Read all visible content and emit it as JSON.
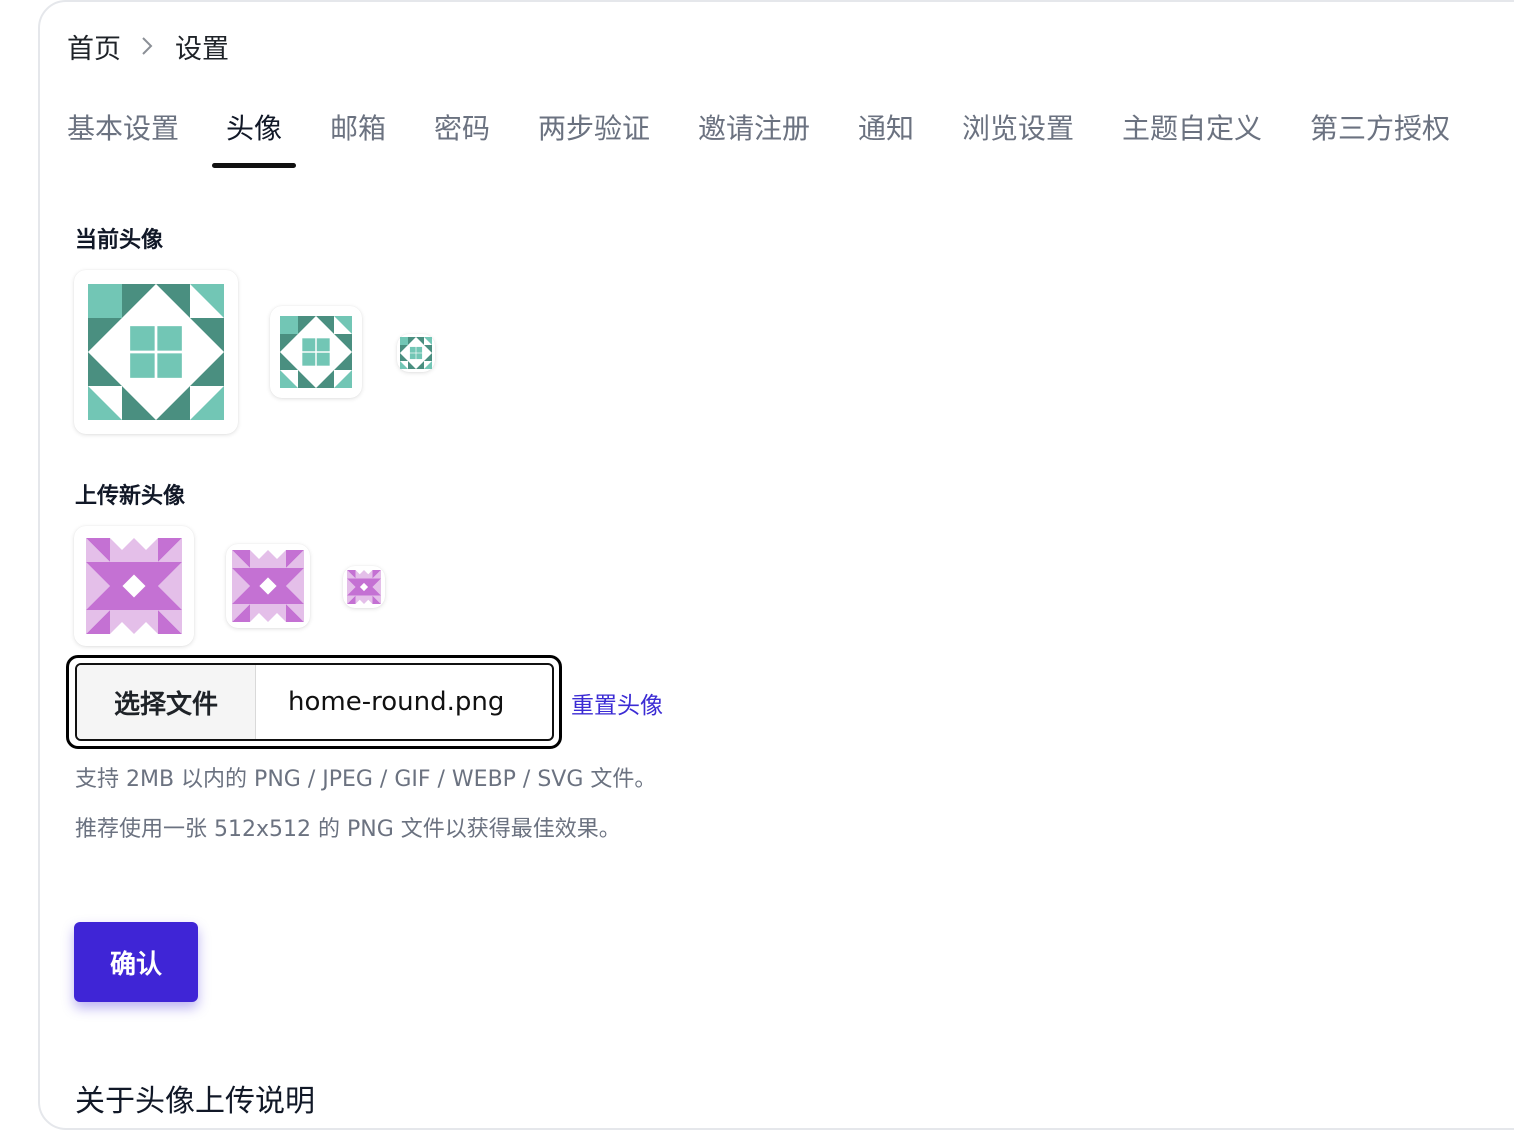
{
  "breadcrumb": {
    "home": "首页",
    "current": "设置"
  },
  "tabs": [
    {
      "label": "基本设置"
    },
    {
      "label": "头像"
    },
    {
      "label": "邮箱"
    },
    {
      "label": "密码"
    },
    {
      "label": "两步验证"
    },
    {
      "label": "邀请注册"
    },
    {
      "label": "通知"
    },
    {
      "label": "浏览设置"
    },
    {
      "label": "主题自定义"
    },
    {
      "label": "第三方授权"
    }
  ],
  "active_tab": "头像",
  "current_avatar": {
    "title": "当前头像",
    "colors": {
      "dark": "#4a8f80",
      "light": "#72c6b5"
    }
  },
  "new_avatar": {
    "title": "上传新头像",
    "colors": {
      "dark": "#c471d3",
      "light": "#e4bfe9"
    }
  },
  "file_input": {
    "button_label": "选择文件",
    "file_name": "home-round.png"
  },
  "reset_link": "重置头像",
  "hints": [
    "支持 2MB 以内的 PNG / JPEG / GIF / WEBP / SVG 文件。",
    "推荐使用一张 512x512 的 PNG 文件以获得最佳效果。"
  ],
  "confirm_button": "确认",
  "about_title": "关于头像上传说明",
  "accent_color": "#3f25d6",
  "link_color": "#3b2bd4"
}
